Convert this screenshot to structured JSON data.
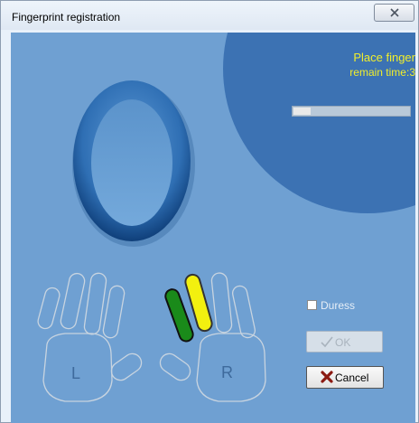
{
  "window": {
    "title": "Fingerprint registration",
    "close_glyph": "☒"
  },
  "status": {
    "line1": "Place finger",
    "line2": "remain time:3",
    "color": "#f1ee2b",
    "progress": 0.15
  },
  "hands": {
    "left_label": "L",
    "right_label": "R",
    "active_fingers": {
      "right_index": "#1a8a1a",
      "right_middle": "#f2f00f"
    }
  },
  "options": {
    "duress_label": "Duress",
    "duress_checked": false
  },
  "buttons": {
    "ok_label": "OK",
    "ok_enabled": false,
    "cancel_label": "Cancel"
  },
  "icons": {
    "ok": "checkmark-icon",
    "cancel": "x-cross-icon",
    "close": "close-icon"
  }
}
